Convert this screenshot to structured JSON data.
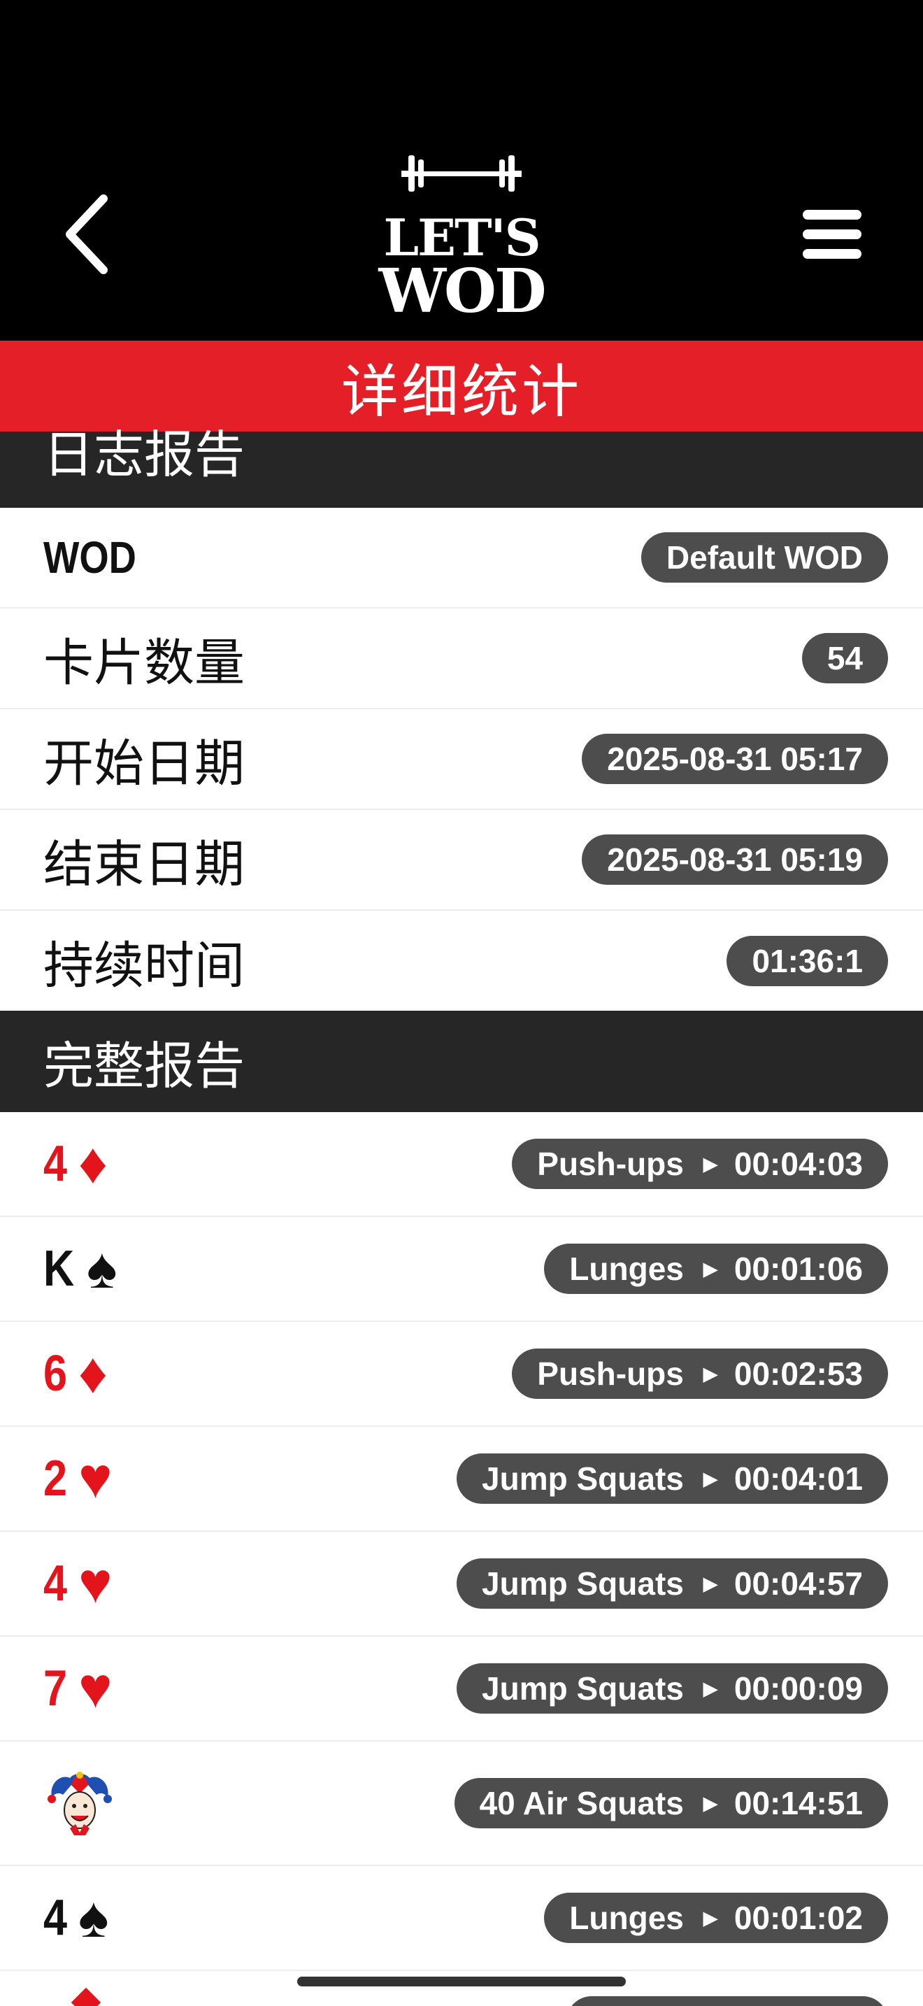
{
  "header": {
    "logo_line1": "LET'S",
    "logo_line2": "WOD"
  },
  "title": "详细统计",
  "log_report": {
    "header": "日志报告",
    "rows": [
      {
        "label": "WOD",
        "value": "Default WOD"
      },
      {
        "label": "卡片数量",
        "value": "54"
      },
      {
        "label": "开始日期",
        "value": "2025-08-31 05:17"
      },
      {
        "label": "结束日期",
        "value": "2025-08-31 05:19"
      },
      {
        "label": "持续时间",
        "value": "01:36:1"
      }
    ]
  },
  "full_report": {
    "header": "完整报告",
    "rows": [
      {
        "rank": "4",
        "suit": "♦",
        "color": "#e3141b",
        "exercise": "Push-ups",
        "time": "00:04:03"
      },
      {
        "rank": "K",
        "suit": "♠",
        "color": "#111111",
        "exercise": "Lunges",
        "time": "00:01:06"
      },
      {
        "rank": "6",
        "suit": "♦",
        "color": "#e3141b",
        "exercise": "Push-ups",
        "time": "00:02:53"
      },
      {
        "rank": "2",
        "suit": "♥",
        "color": "#e3141b",
        "exercise": "Jump Squats",
        "time": "00:04:01"
      },
      {
        "rank": "4",
        "suit": "♥",
        "color": "#e3141b",
        "exercise": "Jump Squats",
        "time": "00:04:57"
      },
      {
        "rank": "7",
        "suit": "♥",
        "color": "#e3141b",
        "exercise": "Jump Squats",
        "time": "00:00:09"
      },
      {
        "rank": "",
        "suit": "joker",
        "color": "#e3141b",
        "exercise": "40 Air Squats",
        "time": "00:14:51"
      },
      {
        "rank": "4",
        "suit": "♠",
        "color": "#111111",
        "exercise": "Lunges",
        "time": "00:01:02"
      }
    ]
  },
  "colors": {
    "accent": "#e51f27",
    "section": "#262626",
    "pill": "#4d4d4d"
  },
  "icons": {
    "back": "chevron-left-icon",
    "menu": "hamburger-menu-icon",
    "logo_barbell": "barbell-icon",
    "joker": "joker-icon",
    "arrow": "play-arrow-icon"
  }
}
